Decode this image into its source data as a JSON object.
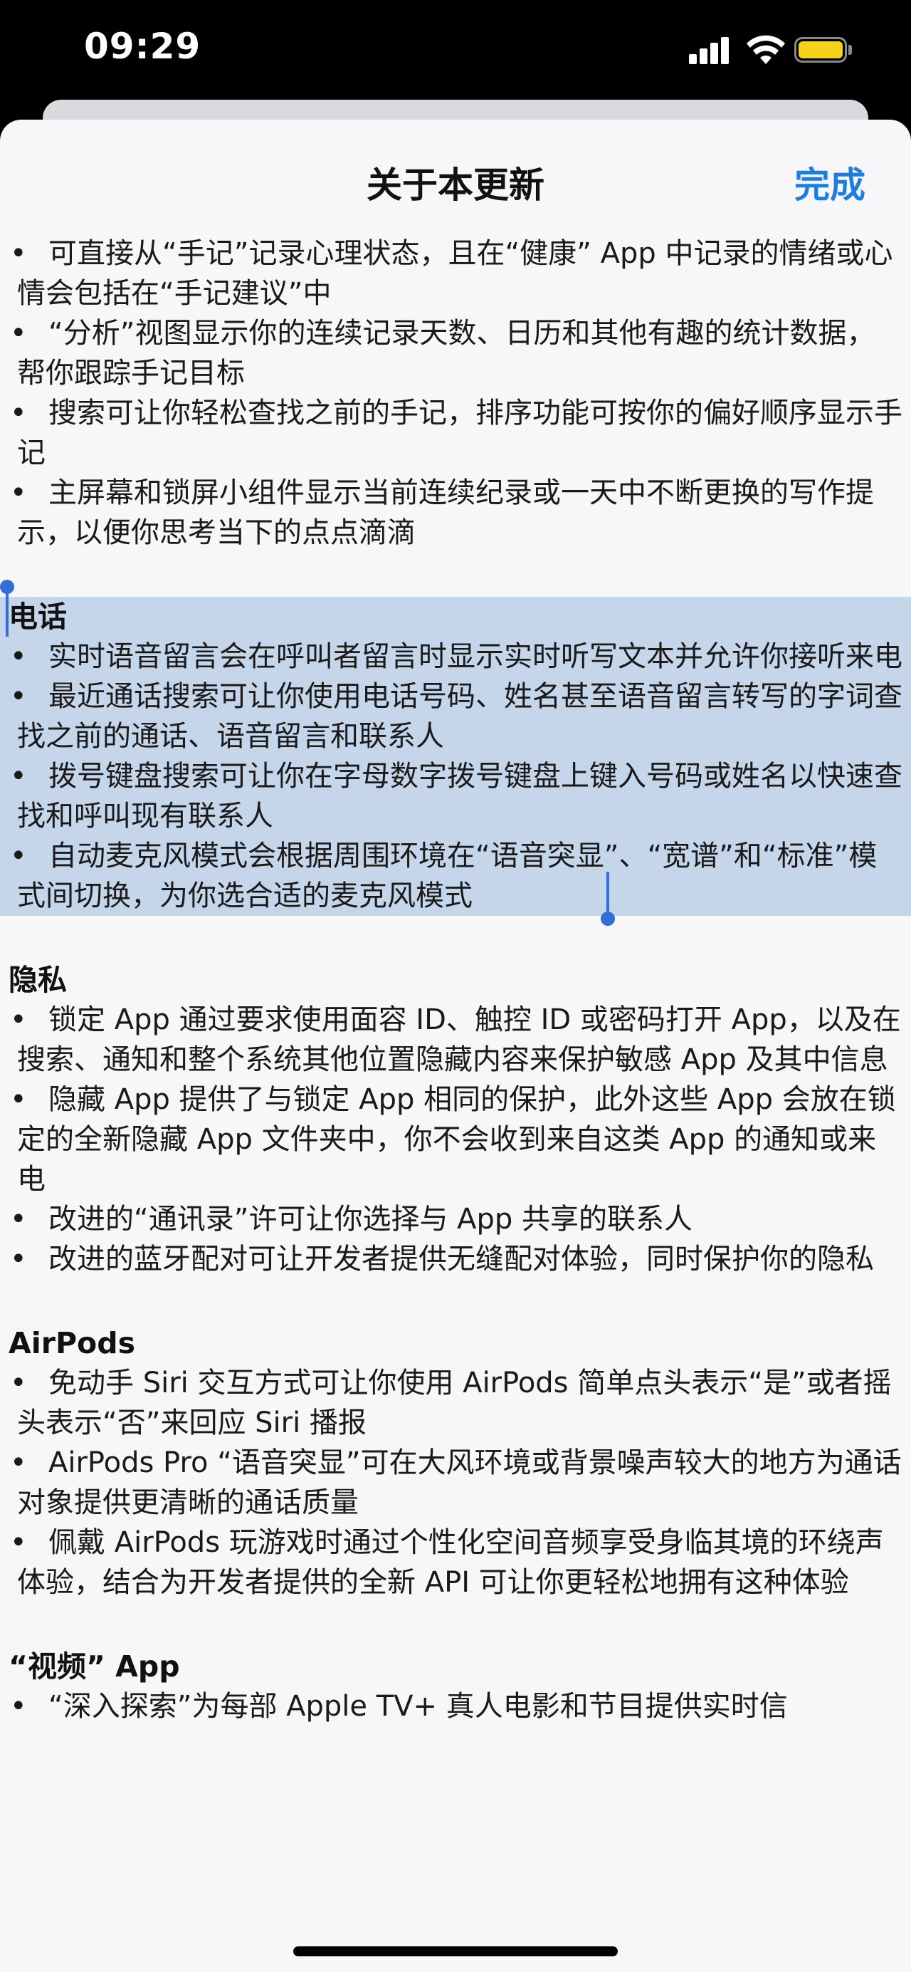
{
  "status": {
    "time": "09:29"
  },
  "sheet": {
    "title": "关于本更新",
    "done_label": "完成"
  },
  "sections": {
    "notes_tail": {
      "items": [
        "可直接从“手记”记录心理状态，且在“健康” App 中记录的情绪或心情会包括在“手记建议”中",
        "“分析”视图显示你的连续记录天数、日历和其他有趣的统计数据，帮你跟踪手记目标",
        "搜索可让你轻松查找之前的手记，排序功能可按你的偏好顺序显示手记",
        "主屏幕和锁屏小组件显示当前连续纪录或一天中不断更换的写作提示，以便你思考当下的点点滴滴"
      ]
    },
    "phone": {
      "heading": "电话",
      "items": [
        "实时语音留言会在呼叫者留言时显示实时听写文本并允许你接听来电",
        "最近通话搜索可让你使用电话号码、姓名甚至语音留言转写的字词查找之前的通话、语音留言和联系人",
        "拨号键盘搜索可让你在字母数字拨号键盘上键入号码或姓名以快速查找和呼叫现有联系人",
        "自动麦克风模式会根据周围环境在“语音突显”、“宽谱”和“标准”模式间切换，为你选合适的麦克风模式"
      ]
    },
    "privacy": {
      "heading": "隐私",
      "items": [
        "锁定 App 通过要求使用面容 ID、触控 ID 或密码打开 App，以及在搜索、通知和整个系统其他位置隐藏内容来保护敏感 App 及其中信息",
        "隐藏 App 提供了与锁定 App 相同的保护，此外这些 App 会放在锁定的全新隐藏 App 文件夹中，你不会收到来自这类 App 的通知或来电",
        "改进的“通讯录”许可让你选择与 App 共享的联系人",
        "改进的蓝牙配对可让开发者提供无缝配对体验，同时保护你的隐私"
      ]
    },
    "airpods": {
      "heading": "AirPods",
      "items": [
        "免动手 Siri 交互方式可让你使用 AirPods 简单点头表示“是”或者摇头表示“否”来回应 Siri 播报",
        "AirPods Pro “语音突显”可在大风环境或背景噪声较大的地方为通话对象提供更清晰的通话质量",
        "佩戴 AirPods 玩游戏时通过个性化空间音频享受身临其境的环绕声体验，结合为开发者提供的全新 API 可让你更轻松地拥有这种体验"
      ]
    },
    "video": {
      "heading": "“视频” App",
      "items": [
        "“深入探索”为每部 Apple TV+ 真人电影和节目提供实时信"
      ]
    }
  }
}
